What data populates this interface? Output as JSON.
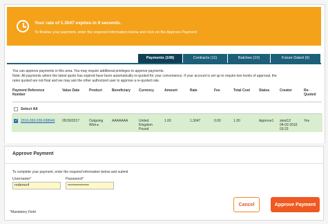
{
  "banner": {
    "icon": "clock-icon",
    "title": "Your rate of 1.3047 expires in 9 seconds.",
    "subtitle": "To finalise your payment, enter the required information below and click on the Approve Payment",
    "color": "#f4a21a"
  },
  "tabs": [
    {
      "label": "Payments (108)",
      "active": true
    },
    {
      "label": "Contracts (11)",
      "active": false
    },
    {
      "label": "Batches (10)",
      "active": false
    },
    {
      "label": "Future Dated (0)",
      "active": false
    }
  ],
  "notes": [
    "You can approve payments in this area. You may require additional privileges to approve payments.",
    "Note: All payments where the latest quote has expired have been automatically re-quoted for your convenience. If your account is set up to require two levels of approval, the",
    "rates quoted are not final and we may ask the other authorized user to approve a re-quoted rate."
  ],
  "table": {
    "headers": {
      "ref": [
        "Payment Reference",
        "Number"
      ],
      "value_date": "Value Date",
      "product": "Product",
      "beneficiary": "Beneficiary",
      "currency": "Currency",
      "amount": "Amount",
      "rate": "Rate",
      "fee": "Fee",
      "total_cost": "Total Cost",
      "status": "Status",
      "creator": "Creator",
      "requoted": [
        "Re-",
        "Quoted"
      ]
    },
    "select_all_label": "Select All",
    "row": {
      "checked": true,
      "ref": "2016-093-028-008646",
      "value_date": "05/30/2017",
      "product": [
        "Outgoing",
        "Wire ▸"
      ],
      "beneficiary": "AAAAAAA",
      "currency": [
        "United",
        "Kingdom",
        "Pound"
      ],
      "amount": "1.00",
      "rate": "1.3047",
      "fee": "0.00",
      "total_cost": "1.30",
      "status": "Approve1",
      "creator": [
        "stest12",
        "04-02-2016",
        "03:23"
      ],
      "requoted": "Yes"
    }
  },
  "approve": {
    "title": "Approve Payment",
    "instruction": "To complete your payment, enter the required information below and submit",
    "username_label": "Username",
    "username_value": "mdemo4",
    "password_label": "Password",
    "password_value": "••••••••••••••••",
    "mandatory_label": "Mandatory Field",
    "cancel_label": "Cancel",
    "approve_label": "Approve Payment"
  },
  "colors": {
    "accent_orange": "#ef5a22",
    "tab_blue": "#1c5f79",
    "row_highlight": "#d9eecf"
  }
}
